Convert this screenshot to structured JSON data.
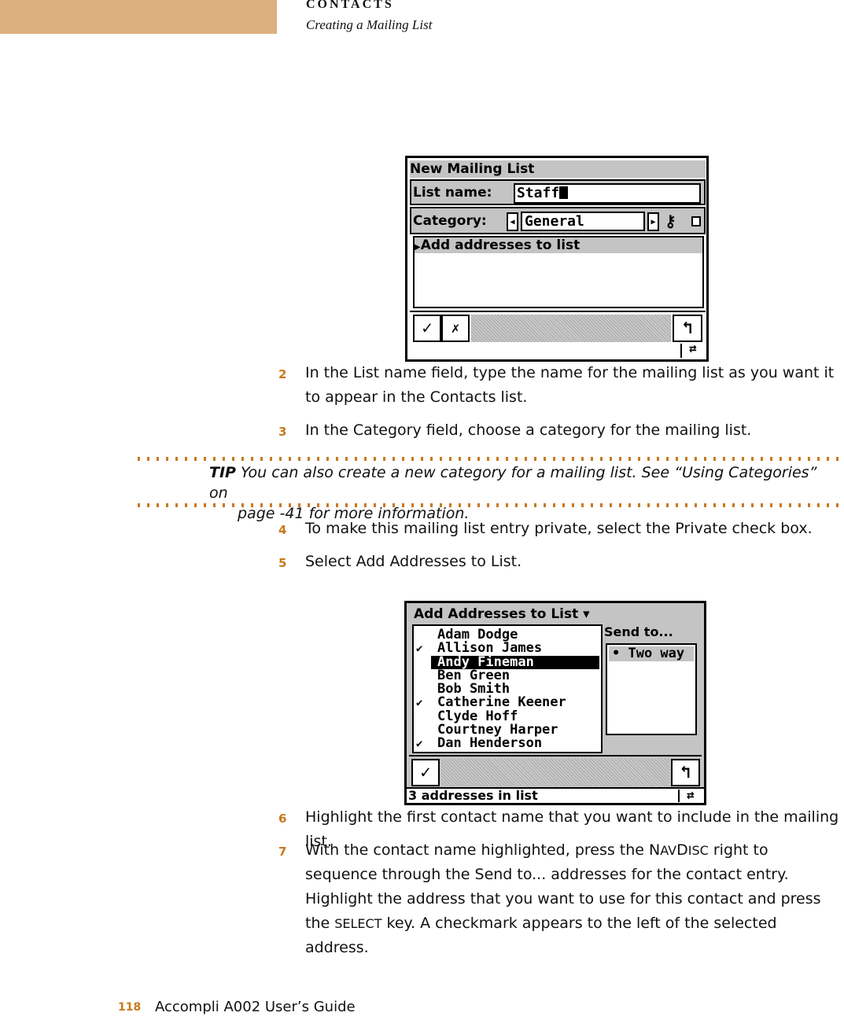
{
  "header": {
    "section": "CONTACTS",
    "subtitle": "Creating a Mailing List",
    "tab_color": "#dcb07f"
  },
  "accent_color": "#c8781e",
  "screen1": {
    "title": "New Mailing List",
    "list_name_label": "List name:",
    "list_name_value": "Staff",
    "category_label": "Category:",
    "category_value": "General",
    "private_icon": "key-icon",
    "menu_item": "Add addresses to list",
    "buttons": {
      "ok": "check-icon",
      "private": "no-private-icon",
      "back": "return-arrow-icon"
    },
    "status_icon": "swap-arrows-icon"
  },
  "steps_a": [
    {
      "num": "2",
      "text": "In the List name field, type the name for the mailing list as you want it to appear in the Contacts list."
    },
    {
      "num": "3",
      "text": "In the Category field, choose a category for the mailing list."
    }
  ],
  "tip": {
    "label": "TIP",
    "text": " You can also create a new category for a mailing list. See “Using Categories” on",
    "text2": "page -41 for more information."
  },
  "steps_b": [
    {
      "num": "4",
      "text": "To make this mailing list entry private, select the Private check box."
    },
    {
      "num": "5",
      "text": "Select Add Addresses to List."
    }
  ],
  "screen2": {
    "title": "Add Addresses to List ▾",
    "contacts": [
      {
        "name": "Adam Dodge",
        "checked": false
      },
      {
        "name": "Allison James",
        "checked": true
      },
      {
        "name": "Andy Fineman",
        "checked": false,
        "selected": true
      },
      {
        "name": "Ben Green",
        "checked": false
      },
      {
        "name": "Bob Smith",
        "checked": false
      },
      {
        "name": "Catherine Keener",
        "checked": true
      },
      {
        "name": "Clyde Hoff",
        "checked": false
      },
      {
        "name": "Courtney Harper",
        "checked": false
      },
      {
        "name": "Dan Henderson",
        "checked": true
      }
    ],
    "check_mark": "✔",
    "send_to_label": "Send to...",
    "send_to_option": "• Two way",
    "status": "3 addresses in list"
  },
  "steps_c": [
    {
      "num": "6",
      "text": "Highlight the first contact name that you want to include in the mailing list."
    },
    {
      "num": "7",
      "text_parts": [
        "With the contact name highlighted, press the N",
        "AV",
        "D",
        "ISC",
        " right to sequence through the Send to... addresses for the contact entry. Highlight the address that you want to use for this contact and press the ",
        "SELECT",
        " key. A checkmark appears to the left of the selected address."
      ]
    }
  ],
  "footer": {
    "page": "118",
    "title": "Accompli A002 User’s Guide"
  }
}
